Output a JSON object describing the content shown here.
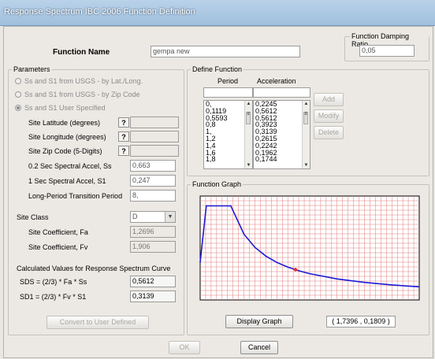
{
  "window": {
    "title": "Response Spectrum IBC 2006 Function Definition"
  },
  "function_name": {
    "label": "Function Name",
    "value": "gempa new"
  },
  "damping": {
    "label": "Function Damping Ratio",
    "value": "0,05"
  },
  "parameters": {
    "label": "Parameters",
    "options": [
      {
        "label": "Ss and S1 from USGS - by Lat./Long.",
        "selected": false
      },
      {
        "label": "Ss and S1 from USGS - by Zip Code",
        "selected": false
      },
      {
        "label": "Ss and S1 User Specified",
        "selected": true
      }
    ],
    "site_latitude": {
      "label": "Site Latitude (degrees)",
      "help": "?",
      "value": ""
    },
    "site_longitude": {
      "label": "Site Longitude (degrees)",
      "help": "?",
      "value": ""
    },
    "site_zip": {
      "label": "Site Zip Code (5-Digits)",
      "help": "?",
      "value": ""
    },
    "ss": {
      "label": "0.2 Sec Spectral Accel, Ss",
      "value": "0,663"
    },
    "s1": {
      "label": "1 Sec Spectral Accel, S1",
      "value": "0,247"
    },
    "tl": {
      "label": "Long-Period Transition Period",
      "value": "8,"
    },
    "site_class": {
      "label": "Site Class",
      "value": "D"
    },
    "fa": {
      "label": "Site Coefficient, Fa",
      "value": "1,2696"
    },
    "fv": {
      "label": "Site Coefficient, Fv",
      "value": "1,906"
    },
    "calc_label": "Calculated Values for Response Spectrum Curve",
    "sds": {
      "label": "SDS = (2/3) * Fa * Ss",
      "value": "0,5612"
    },
    "sd1": {
      "label": "SD1 = (2/3) * Fv * S1",
      "value": "0,3139"
    },
    "convert_button": "Convert to User Defined"
  },
  "define_function": {
    "label": "Define Function",
    "period_header": "Period",
    "accel_header": "Acceleration",
    "period_input": "",
    "accel_input": "",
    "periods": [
      "0,",
      "0,1119",
      "0,5593",
      "0,8",
      "1,",
      "1,2",
      "1,4",
      "1,6",
      "1,8"
    ],
    "accelerations": [
      "0,2245",
      "0,5612",
      "0,5612",
      "0,3923",
      "0,3139",
      "0,2615",
      "0,2242",
      "0,1962",
      "0,1744"
    ],
    "add_button": "Add",
    "modify_button": "Modify",
    "delete_button": "Delete"
  },
  "graph": {
    "label": "Function Graph",
    "display_button": "Display Graph",
    "coordinate_readout": "( 1,7396 ,  0,1809 )",
    "line_color": "#1b1bd6",
    "marker_color": "#e03030",
    "grid_color": "#e27b7b",
    "background_color": "#ffffff"
  },
  "chart_data": {
    "type": "line",
    "x": [
      0,
      0.1119,
      0.5593,
      0.8,
      1.0,
      1.2,
      1.4,
      1.6,
      1.8,
      2.0,
      2.5,
      3.0,
      3.5,
      4.0
    ],
    "y": [
      0.2245,
      0.5612,
      0.5612,
      0.3923,
      0.3139,
      0.2615,
      0.2242,
      0.1962,
      0.1744,
      0.157,
      0.1256,
      0.1046,
      0.0897,
      0.0785
    ],
    "marker": {
      "x": 1.7396,
      "y": 0.1809
    },
    "xlim": [
      0,
      4.0
    ],
    "ylim": [
      0,
      0.62
    ],
    "grid": true,
    "title": "",
    "xlabel": "",
    "ylabel": ""
  },
  "footer": {
    "ok_button": "OK",
    "cancel_button": "Cancel"
  }
}
